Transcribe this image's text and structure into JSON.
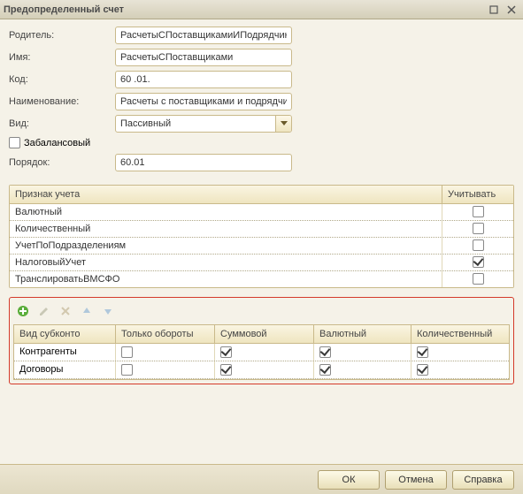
{
  "window": {
    "title": "Предопределенный счет"
  },
  "form": {
    "parent_label": "Родитель:",
    "parent_value": "РасчетыСПоставщикамиИПодрядчик",
    "name_label": "Имя:",
    "name_value": "РасчетыСПоставщиками",
    "code_label": "Код:",
    "code_value": "60 .01.",
    "descr_label": "Наименование:",
    "descr_value": "Расчеты с поставщиками и подрядчи",
    "type_label": "Вид:",
    "type_value": "Пассивный",
    "offbalance_label": "Забалансовый",
    "offbalance_checked": false,
    "order_label": "Порядок:",
    "order_value": "60.01"
  },
  "grid1": {
    "header_attr": "Признак учета",
    "header_use": "Учитывать",
    "rows": [
      {
        "label": "Валютный",
        "checked": false
      },
      {
        "label": "Количественный",
        "checked": false
      },
      {
        "label": "УчетПоПодразделениям",
        "checked": false
      },
      {
        "label": "НалоговыйУчет",
        "checked": true
      },
      {
        "label": "ТранслироватьВМСФО",
        "checked": false
      }
    ]
  },
  "grid2": {
    "headers": {
      "c1": "Вид субконто",
      "c2": "Только обороты",
      "c3": "Суммовой",
      "c4": "Валютный",
      "c5": "Количественный"
    },
    "rows": [
      {
        "label": "Контрагенты",
        "c2": false,
        "c3": true,
        "c4": true,
        "c5": true
      },
      {
        "label": "Договоры",
        "c2": false,
        "c3": true,
        "c4": true,
        "c5": true
      }
    ]
  },
  "footer": {
    "ok": "ОК",
    "cancel": "Отмена",
    "help": "Справка"
  }
}
